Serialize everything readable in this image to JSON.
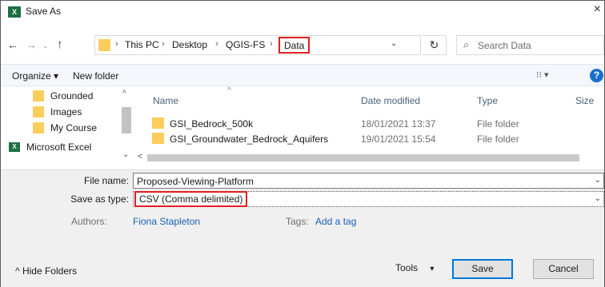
{
  "window": {
    "title": "Save As",
    "app_icon": "X",
    "close_glyph": "×"
  },
  "nav": {
    "back": "←",
    "forward": "→",
    "recent": "⌄",
    "up": "↑",
    "refresh": "↻"
  },
  "address": {
    "crumbs": [
      "This PC",
      "Desktop",
      "QGIS-FS"
    ],
    "separator": "›",
    "current": "Data",
    "dropdown": "⌄"
  },
  "search": {
    "icon": "⌕",
    "placeholder": "Search Data"
  },
  "toolbar": {
    "organize": "Organize ▾",
    "new_folder": "New folder",
    "view": "⁝⁝ ▾",
    "help": "?"
  },
  "nav_pane": {
    "items": [
      {
        "label": "Grounded",
        "icon": "folder"
      },
      {
        "label": "Images",
        "icon": "folder"
      },
      {
        "label": "My Course",
        "icon": "folder"
      },
      {
        "label": "Microsoft Excel",
        "icon": "excel"
      }
    ],
    "scroll_up": "^",
    "scroll_down": "⌄"
  },
  "files": {
    "columns": [
      "Name",
      "Date modified",
      "Type",
      "Size"
    ],
    "sort_caret": "^",
    "rows": [
      {
        "name": "GSI_Bedrock_500k",
        "date": "18/01/2021 13:37",
        "type": "File folder"
      },
      {
        "name": "GSI_Groundwater_Bedrock_Aquifers",
        "date": "19/01/2021 15:54",
        "type": "File folder"
      }
    ],
    "hscroll_left": "<"
  },
  "form": {
    "file_name_label": "File name:",
    "file_name_value": "Proposed-Viewing-Platform",
    "save_type_label": "Save as type:",
    "save_type_value": "CSV (Comma delimited)",
    "dropdown": "⌄",
    "authors_label": "Authors:",
    "authors_value": "Fiona Stapleton",
    "tags_label": "Tags:",
    "tags_value": "Add a tag"
  },
  "footer": {
    "hide_folders": "^ Hide Folders",
    "tools": "Tools",
    "tools_caret": "▾",
    "save": "Save",
    "cancel": "Cancel"
  },
  "colors": {
    "highlight": "#e02020",
    "link": "#1a5fb4",
    "folder": "#fccd5c",
    "excel": "#1d6f42"
  }
}
